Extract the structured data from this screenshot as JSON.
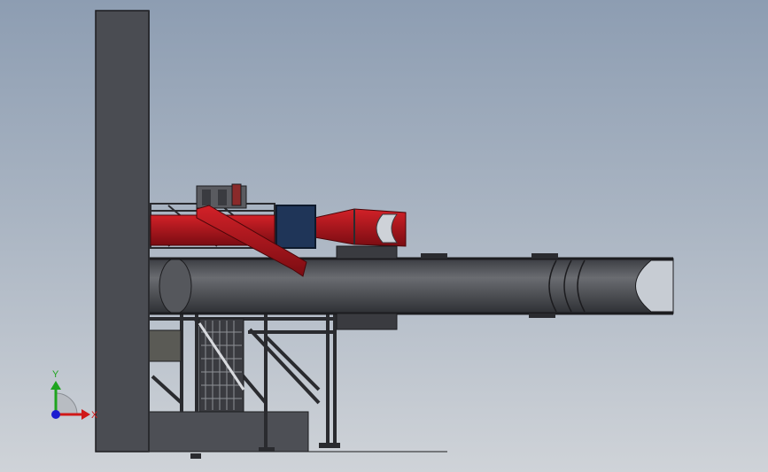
{
  "viewport": {
    "background_top": "#8d9db2",
    "background_bottom": "#cfd3d8"
  },
  "model": {
    "colors": {
      "column": "#4a4c52",
      "column_edge": "#1c1c1f",
      "main_duct": "#4b4d52",
      "main_duct_light": "#6a6c71",
      "red_duct": "#b3121a",
      "red_duct_dark": "#6e0b10",
      "blue_box": "#1f3558",
      "steel": "#2d2e32",
      "base_block": "#4d4f55"
    }
  },
  "triad": {
    "y_label": "Y",
    "x_label": "X",
    "y_color": "#1ea41e",
    "x_color": "#d01818",
    "z_color": "#1c1cd0"
  }
}
